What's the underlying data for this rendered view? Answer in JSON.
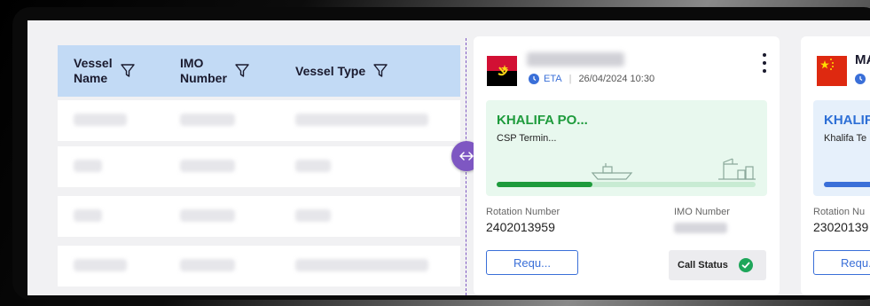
{
  "table": {
    "columns": [
      {
        "label": "Vessel\nName",
        "icon": "filter-icon"
      },
      {
        "label": "IMO\nNumber",
        "icon": "filter-icon"
      },
      {
        "label": "Vessel Type",
        "icon": "filter-icon"
      }
    ],
    "rows_note": "row cell values are blurred in the screenshot"
  },
  "card1": {
    "flag": "angola-flag",
    "eta_label": "ETA",
    "eta_time": "26/04/2024 10:30",
    "terminal_name": "KHALIFA PO...",
    "terminal_sub": "CSP Termin...",
    "progress": 0.37,
    "rotation_label": "Rotation Number",
    "rotation_value": "2402013959",
    "imo_label": "IMO Number",
    "request_label": "Requ...",
    "call_status_label": "Call Status",
    "colors": {
      "terminal_bg": "#e8f8ee",
      "terminal_text": "#1e9b3c",
      "accent": "#3a6fd8"
    }
  },
  "card2": {
    "flag": "china-flag",
    "name": "MA",
    "terminal_name": "KHALIF",
    "terminal_sub": "Khalifa Te",
    "rotation_label": "Rotation Nu",
    "rotation_value": "23020139",
    "request_label": "Requ..."
  },
  "handle": {
    "icon": "resize-arrows-icon",
    "color": "#7e57c2"
  }
}
